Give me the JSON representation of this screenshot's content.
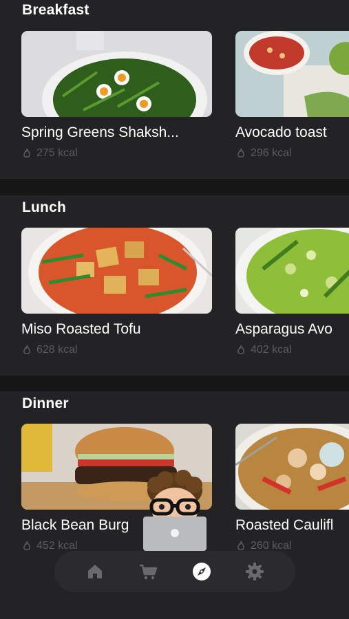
{
  "sections": [
    {
      "title": "Breakfast",
      "cards": [
        {
          "name": "Spring Greens Shaksh...",
          "kcal": "275 kcal"
        },
        {
          "name": "Avocado toast",
          "kcal": "296 kcal"
        }
      ]
    },
    {
      "title": "Lunch",
      "cards": [
        {
          "name": "Miso Roasted Tofu",
          "kcal": "628 kcal"
        },
        {
          "name": "Asparagus Avo",
          "kcal": "402 kcal"
        }
      ]
    },
    {
      "title": "Dinner",
      "cards": [
        {
          "name": "Black Bean Burg",
          "kcal": "452 kcal"
        },
        {
          "name": "Roasted Caulifl",
          "kcal": "260 kcal"
        }
      ]
    }
  ],
  "nav": {
    "items": [
      "home-icon",
      "cart-icon",
      "compass-icon",
      "gear-icon"
    ],
    "active": "compass-icon"
  },
  "colors": {
    "background": "#161616",
    "section": "#232325",
    "muted_text": "#5c5c60",
    "nav_bg": "#2b2b2d"
  }
}
